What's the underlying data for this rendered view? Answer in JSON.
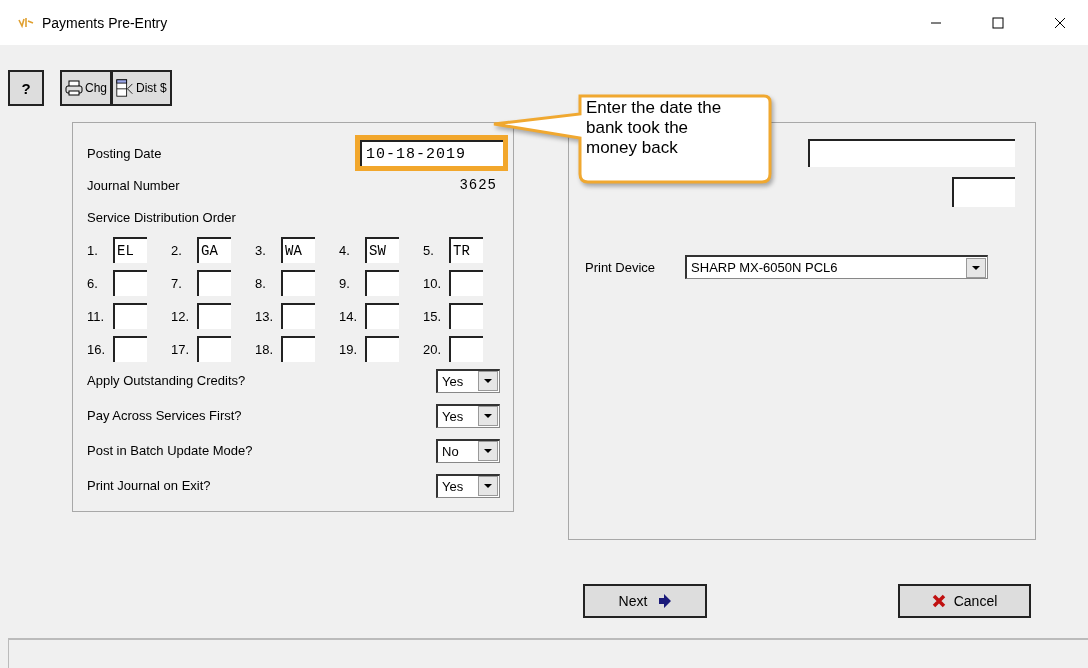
{
  "window": {
    "title": "Payments Pre-Entry"
  },
  "toolbar": [
    {
      "kind": "help",
      "label": "?"
    },
    {
      "kind": "printer",
      "label": "Chg"
    },
    {
      "kind": "dist",
      "label": "Dist $"
    }
  ],
  "posting_date": {
    "label": "Posting Date",
    "value": "10-18-2019",
    "highlighted": true
  },
  "journal_number": {
    "label": "Journal Number",
    "value": "3625"
  },
  "service_order": {
    "label": "Service Distribution Order",
    "slots": [
      {
        "label": "1.",
        "value": "EL"
      },
      {
        "label": "2.",
        "value": "GA"
      },
      {
        "label": "3.",
        "value": "WA"
      },
      {
        "label": "4.",
        "value": "SW"
      },
      {
        "label": "5.",
        "value": "TR"
      },
      {
        "label": "6."
      },
      {
        "label": "7."
      },
      {
        "label": "8."
      },
      {
        "label": "9."
      },
      {
        "label": "10."
      },
      {
        "label": "11."
      },
      {
        "label": "12."
      },
      {
        "label": "13."
      },
      {
        "label": "14."
      },
      {
        "label": "15."
      },
      {
        "label": "16."
      },
      {
        "label": "17."
      },
      {
        "label": "18."
      },
      {
        "label": "19."
      },
      {
        "label": "20."
      }
    ]
  },
  "options": [
    {
      "label": "Apply Outstanding Credits?",
      "value": "Yes"
    },
    {
      "label": "Pay Across Services First?",
      "value": "Yes"
    },
    {
      "label": "Post in Batch Update Mode?",
      "value": "No"
    },
    {
      "label": "Print Journal on Exit?",
      "value": "Yes"
    }
  ],
  "callout": {
    "text": "Enter the date the bank took the money back"
  },
  "print_device": {
    "label": "Print Device",
    "value": "SHARP MX-6050N PCL6"
  },
  "buttons": [
    {
      "kind": "next",
      "label": "Next"
    },
    {
      "kind": "cancel",
      "label": "Cancel"
    }
  ]
}
